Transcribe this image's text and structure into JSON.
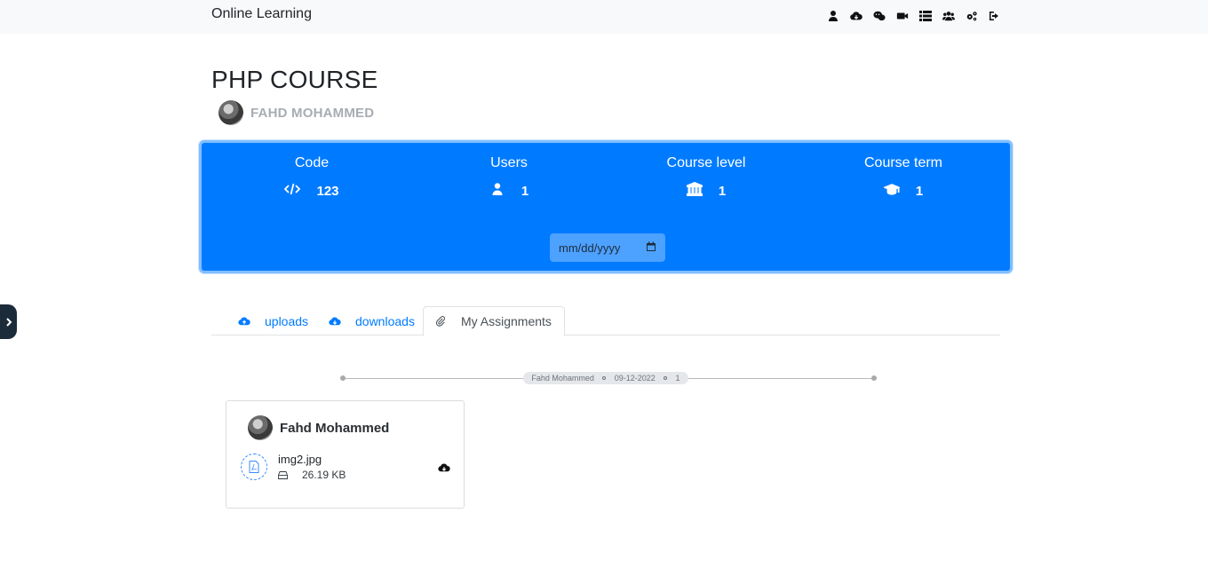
{
  "navbar": {
    "brand": "Online Learning",
    "icons": [
      "user-icon",
      "cloud-download-icon",
      "chat-icon",
      "video-icon",
      "list-icon",
      "users-icon",
      "settings-icon",
      "logout-icon"
    ]
  },
  "course": {
    "title": "PHP COURSE",
    "instructor": "FAHD MOHAMMED"
  },
  "info_panel": {
    "color": "#007bff",
    "stats": [
      {
        "label": "Code",
        "value": "123",
        "icon": "code-icon"
      },
      {
        "label": "Users",
        "value": "1",
        "icon": "user-icon"
      },
      {
        "label": "Course level",
        "value": "1",
        "icon": "institution-icon"
      },
      {
        "label": "Course term",
        "value": "1",
        "icon": "graduation-cap-icon"
      }
    ],
    "date_placeholder": "mm/dd/yyyy"
  },
  "tabs": [
    {
      "label": "uploads",
      "icon": "cloud-upload-icon",
      "active": false
    },
    {
      "label": "downloads",
      "icon": "cloud-download-icon",
      "active": false
    },
    {
      "label": "My Assignments",
      "icon": "paperclip-icon",
      "active": true
    }
  ],
  "timeline": {
    "name": "Fahd Mohammed",
    "date": "09-12-2022",
    "count": "1"
  },
  "assignment_card": {
    "user": "Fahd Mohammed",
    "file_name": "img2.jpg",
    "file_size": "26.19 KB"
  }
}
